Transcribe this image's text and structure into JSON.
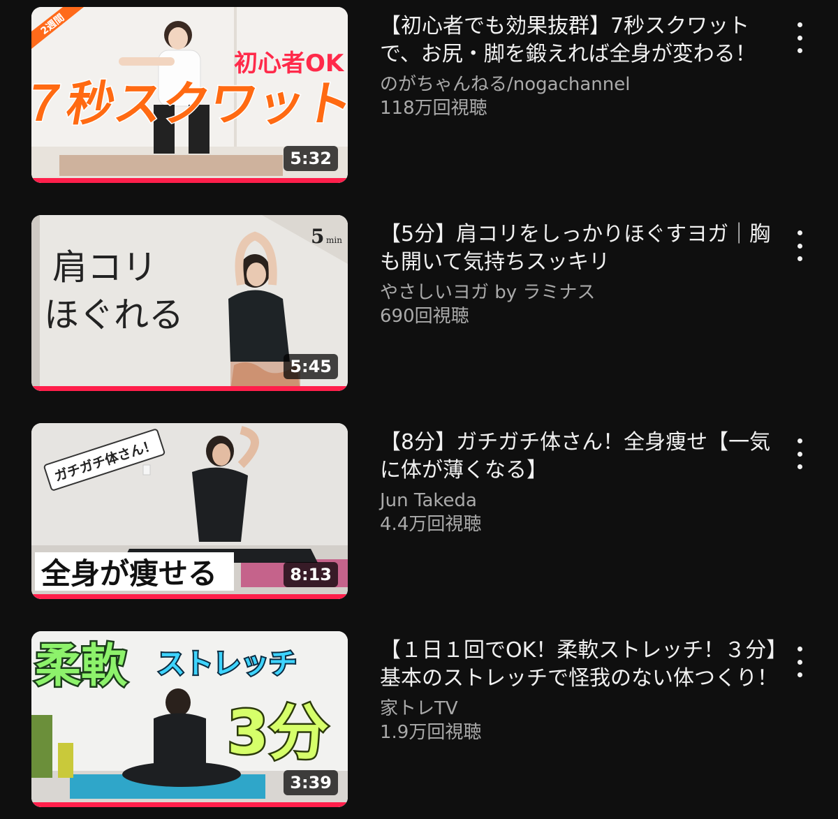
{
  "videos": [
    {
      "title": "【初心者でも効果抜群】7秒スクワットで、お尻・脚を鍛えれば全身が変わる！",
      "channel": "のがちゃんねる/nogachannel",
      "views": "118万回視聴",
      "duration": "5:32",
      "watched_fraction": 1.0,
      "thumb_text": {
        "badge": "2週間",
        "sub": "初心者OK",
        "main": "７秒スクワット"
      }
    },
    {
      "title": "【5分】肩コリをしっかりほぐすヨガ｜胸も開いて気持ちスッキリ",
      "channel": "やさしいヨガ by ラミナス",
      "views": "690回視聴",
      "duration": "5:45",
      "watched_fraction": 1.0,
      "thumb_text": {
        "line1": "肩コリ",
        "line2": "ほぐれる",
        "corner_num": "5",
        "corner_unit": "min"
      }
    },
    {
      "title": "【8分】ガチガチ体さん！全身痩せ【一気に体が薄くなる】",
      "channel": "Jun Takeda",
      "views": "4.4万回視聴",
      "duration": "8:13",
      "watched_fraction": 1.0,
      "thumb_text": {
        "tag": "ガチガチ体さん！",
        "main": "全身が痩せる"
      }
    },
    {
      "title": "【１日１回でOK！柔軟ストレッチ！３分】基本のストレッチで怪我のない体つくり！",
      "channel": "家トレTV",
      "views": "1.9万回視聴",
      "duration": "3:39",
      "watched_fraction": 1.0,
      "thumb_text": {
        "main1": "柔軟",
        "main2": "ストレッチ",
        "main3": "3分"
      }
    }
  ],
  "colors": {
    "background": "#0f0f0f",
    "progress": "#ff1f4b",
    "secondary_text": "#aaaaaa"
  },
  "icons": {
    "menu": "more-vert-icon"
  }
}
